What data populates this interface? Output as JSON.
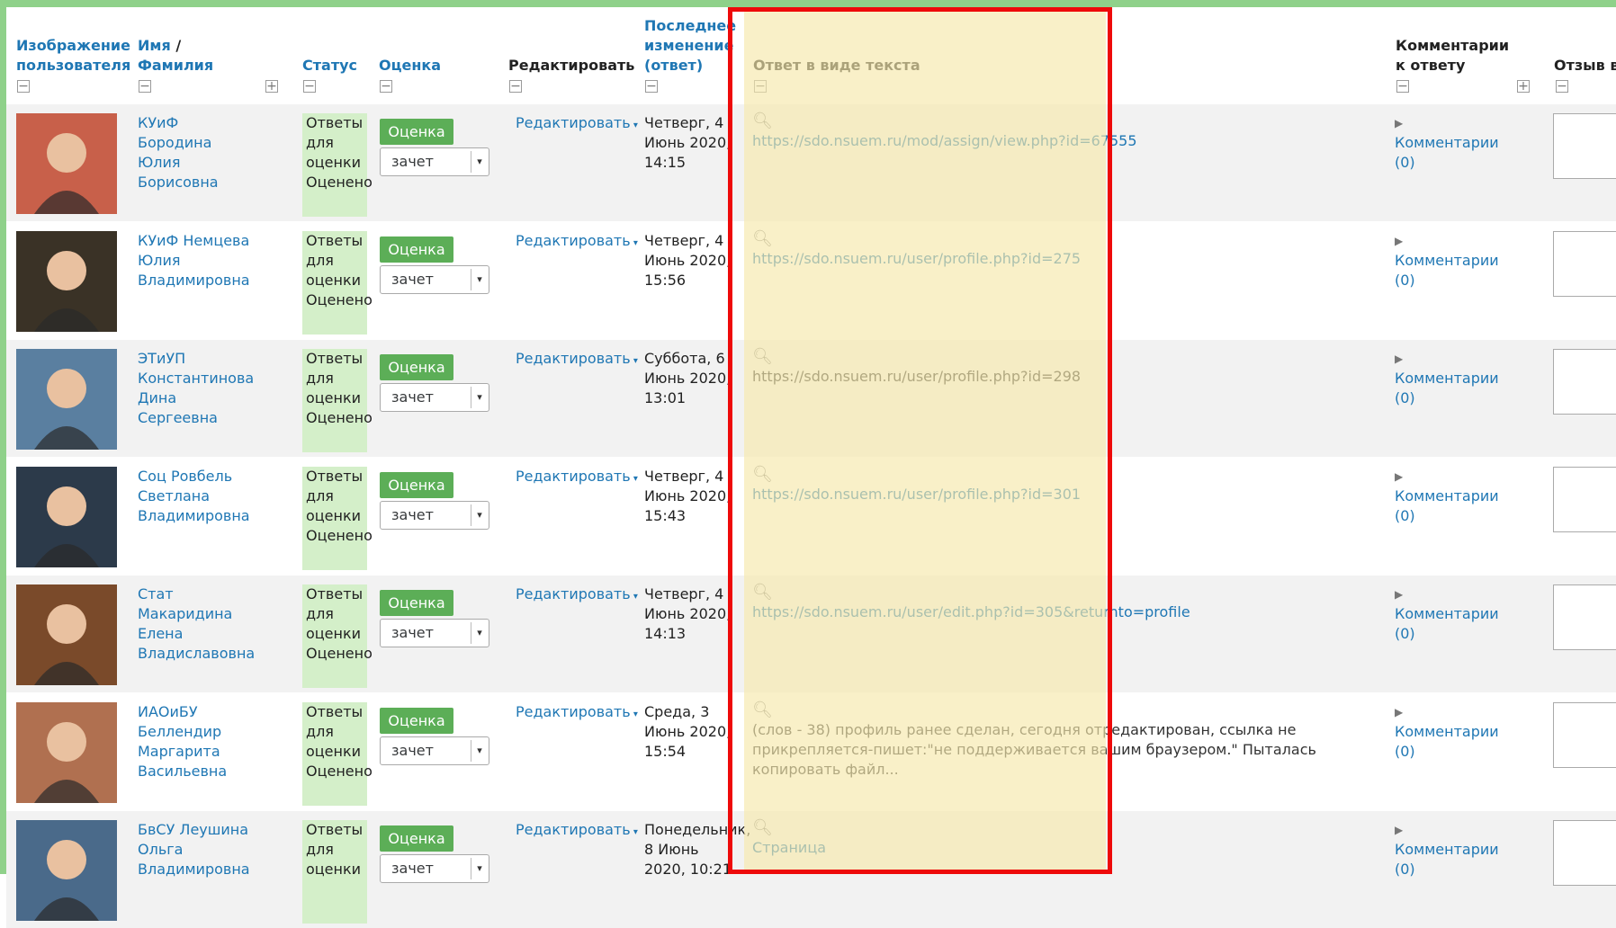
{
  "headers": {
    "image": "Изображение пользователя",
    "name_first": "Имя",
    "name_sep": " / ",
    "name_last": "Фамилия",
    "status": "Статус",
    "grade": "Оценка",
    "edit": "Редактировать",
    "modified": "Последнее изменение (ответ)",
    "text_answer": "Ответ в виде текста",
    "comments": "Комментарии к ответу",
    "feedback": "Отзыв в"
  },
  "rows": [
    {
      "name": "КУиФ Бородина Юлия Борисовна",
      "status": "Ответы для оценки Оценено",
      "grade_btn": "Оценка",
      "grade_value": "зачет",
      "edit": "Редактировать",
      "date": "Четверг, 4 Июнь 2020, 14:15",
      "answer": "https://sdo.nsuem.ru/mod/assign/view.php?id=67555",
      "answer_type": "url",
      "comments": "Комментарии (0)"
    },
    {
      "name": "КУиФ Немцева Юлия Владимировна",
      "status": "Ответы для оценки Оценено",
      "grade_btn": "Оценка",
      "grade_value": "зачет",
      "edit": "Редактировать",
      "date": "Четверг, 4 Июнь 2020, 15:56",
      "answer": "https://sdo.nsuem.ru/user/profile.php?id=275",
      "answer_type": "url",
      "comments": "Комментарии (0)"
    },
    {
      "name": "ЭТиУП Константинова Дина Сергеевна",
      "status": "Ответы для оценки Оценено",
      "grade_btn": "Оценка",
      "grade_value": "зачет",
      "edit": "Редактировать",
      "date": "Суббота, 6 Июнь 2020, 13:01",
      "answer": "https://sdo.nsuem.ru/user/profile.php?id=298",
      "answer_type": "plain",
      "comments": "Комментарии (0)"
    },
    {
      "name": "Соц Ровбель Светлана Владимировна",
      "status": "Ответы для оценки Оценено",
      "grade_btn": "Оценка",
      "grade_value": "зачет",
      "edit": "Редактировать",
      "date": "Четверг, 4 Июнь 2020, 15:43",
      "answer": "https://sdo.nsuem.ru/user/profile.php?id=301",
      "answer_type": "url",
      "comments": "Комментарии (0)"
    },
    {
      "name": "Стат Макаридина Елена Владиславовна",
      "status": "Ответы для оценки Оценено",
      "grade_btn": "Оценка",
      "grade_value": "зачет",
      "edit": "Редактировать",
      "date": "Четверг, 4 Июнь 2020, 14:13",
      "answer": "https://sdo.nsuem.ru/user/edit.php?id=305&returnto=profile",
      "answer_type": "url",
      "comments": "Комментарии (0)"
    },
    {
      "name": "ИАОиБУ Беллендир Маргарита Васильевна",
      "status": "Ответы для оценки Оценено",
      "grade_btn": "Оценка",
      "grade_value": "зачет",
      "edit": "Редактировать",
      "date": "Среда, 3 Июнь 2020, 15:54",
      "answer": "(слов - 38) профиль ранее сделан, сегодня отредактирован, ссылка не прикрепляется-пишет:\"не поддерживается вашим браузером.\" Пыталась копировать файл...",
      "answer_type": "plain",
      "comments": "Комментарии (0)"
    },
    {
      "name": "БвСУ Леушина Ольга Владимировна",
      "status": "Ответы для оценки",
      "grade_btn": "Оценка",
      "grade_value": "зачет",
      "edit": "Редактировать",
      "date": "Понедельник, 8 Июнь 2020, 10:21",
      "answer": "Страница",
      "answer_type": "url",
      "comments": "Комментарии (0)"
    }
  ],
  "avatar_colors": [
    "#c8604a",
    "#3a3226",
    "#5a7fa0",
    "#2c3a4a",
    "#7a4a2a",
    "#b07050",
    "#4a6a8a"
  ],
  "icons": {
    "collapse": "minus-box-icon",
    "expand": "plus-box-icon",
    "preview": "magnifier-icon",
    "caret": "caret-down-icon",
    "expand_comments": "triangle-right-icon"
  }
}
